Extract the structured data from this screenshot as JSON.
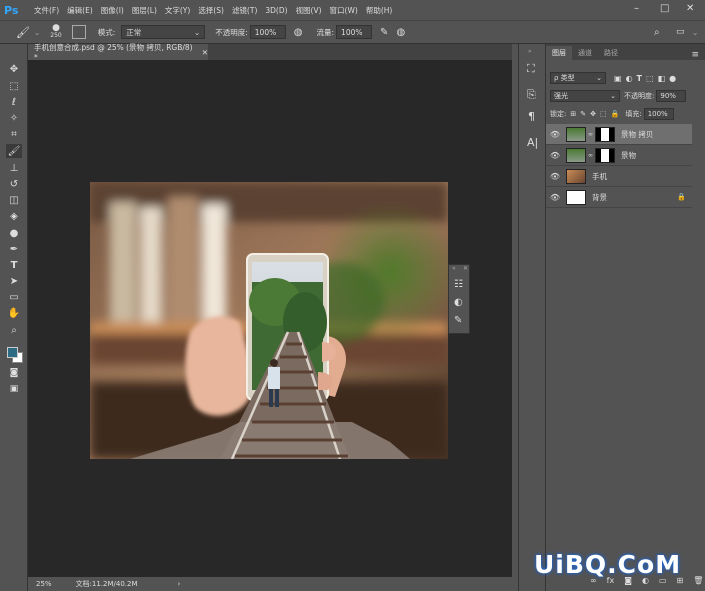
{
  "app": {
    "logo": "Ps"
  },
  "menu": {
    "items": [
      "文件(F)",
      "编辑(E)",
      "图像(I)",
      "图层(L)",
      "文字(Y)",
      "选择(S)",
      "滤镜(T)",
      "3D(D)",
      "视图(V)",
      "窗口(W)",
      "帮助(H)"
    ]
  },
  "options": {
    "brush_size": "250",
    "mode_label": "模式:",
    "mode_value": "正常",
    "opacity_label": "不透明度:",
    "opacity_value": "100%",
    "flow_label": "流量:",
    "flow_value": "100%"
  },
  "document": {
    "tab_title": "手机创意合成.psd @ 25% (景物 拷贝, RGB/8) *"
  },
  "status": {
    "zoom": "25%",
    "doc_info": "文档:11.2M/40.2M"
  },
  "layers_panel": {
    "tabs": [
      "图层",
      "通道",
      "路径"
    ],
    "filter_label": "ρ 类型",
    "blend_mode": "强光",
    "opacity_label": "不透明度:",
    "opacity_value": "90%",
    "lock_label": "锁定:",
    "fill_label": "填充:",
    "fill_value": "100%",
    "layers": [
      {
        "name": "景物 拷贝",
        "selected": true
      },
      {
        "name": "景物",
        "selected": false
      },
      {
        "name": "手机",
        "selected": false
      },
      {
        "name": "背景",
        "selected": false
      }
    ]
  },
  "watermark": "UiBQ.CoM",
  "colors": {
    "foreground": "#2d6b82",
    "background": "#ffffff",
    "accent": "#31a8ff"
  }
}
